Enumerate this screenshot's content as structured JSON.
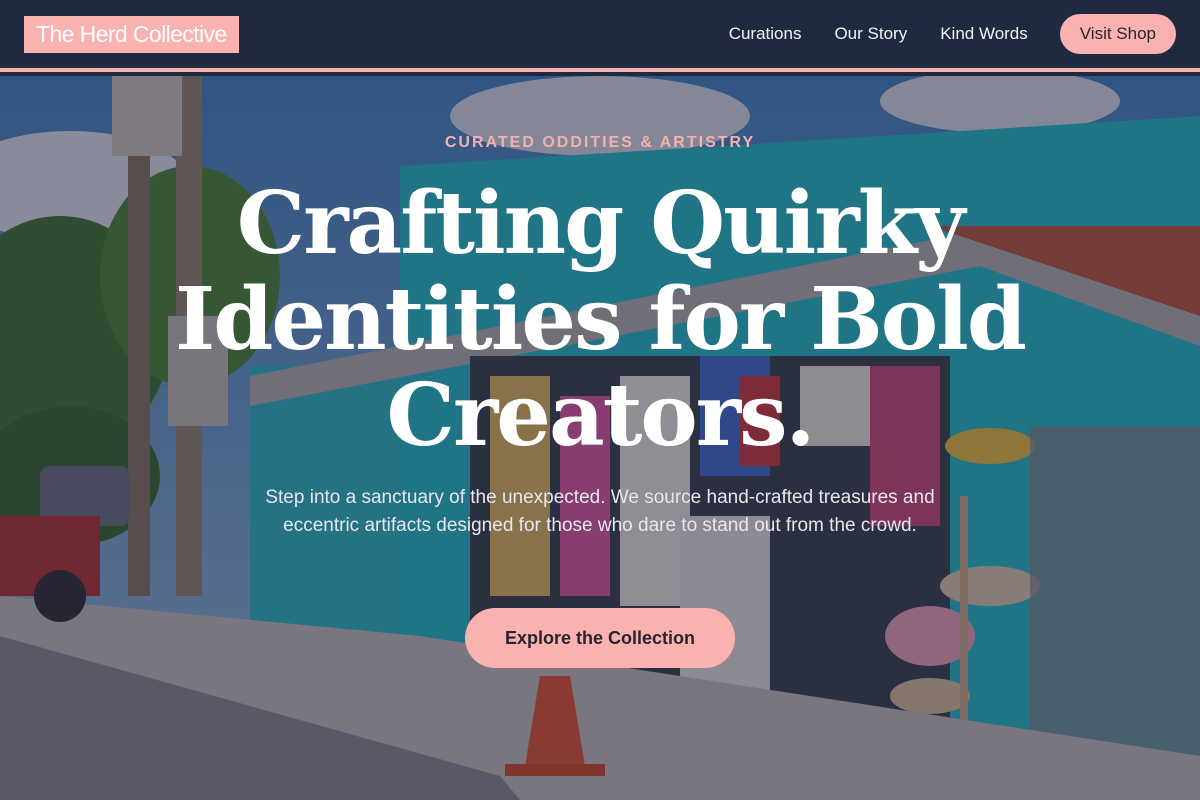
{
  "brand": {
    "name": "The Herd Collective"
  },
  "nav": {
    "links": [
      "Curations",
      "Our Story",
      "Kind Words"
    ],
    "shop_label": "Visit Shop"
  },
  "hero": {
    "eyebrow": "CURATED ODDITIES & ARTISTRY",
    "headline": "Crafting Quirky Identities for Bold Creators.",
    "lede": "Step into a sanctuary of the unexpected. We source hand-crafted treasures and eccentric artifacts designed for those who dare to stand out from the crowd.",
    "cta_label": "Explore the Collection"
  },
  "colors": {
    "header_bg": "#1f2a40",
    "accent_pink": "#f9b2b0",
    "accent_text": "#2b2230",
    "eyebrow_pink": "#f5b0ad"
  }
}
